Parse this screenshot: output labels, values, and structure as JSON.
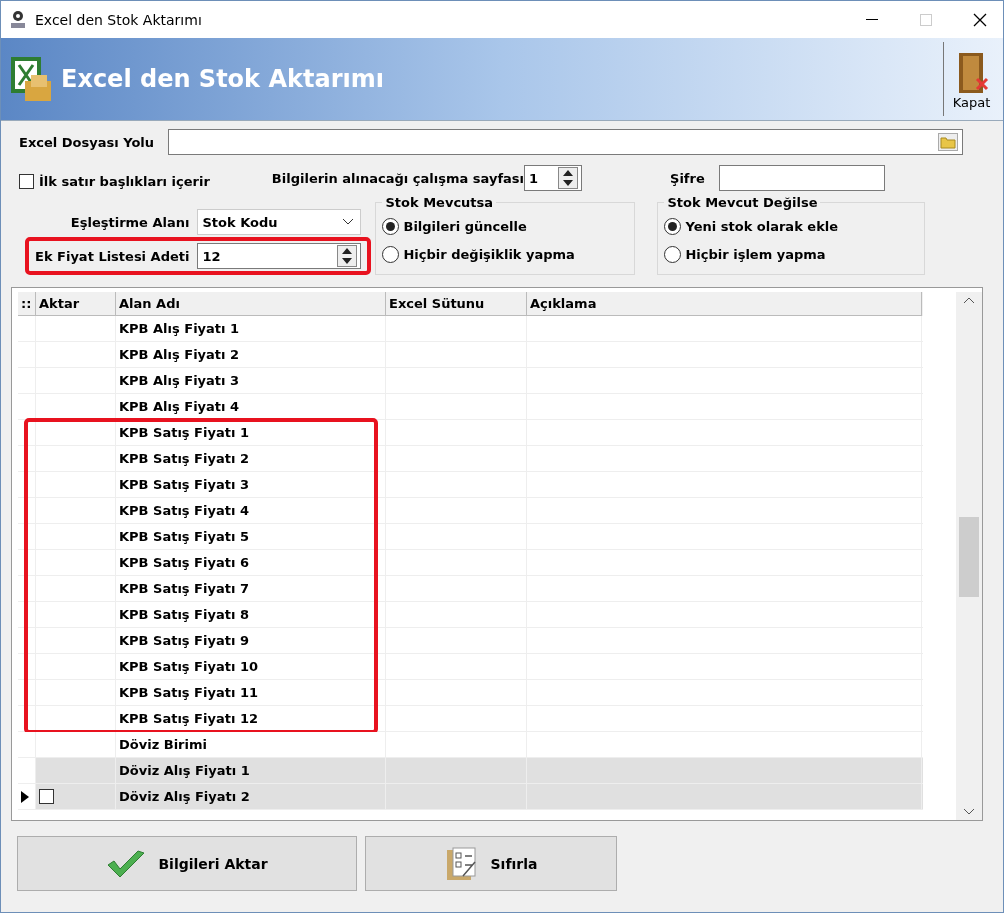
{
  "window": {
    "title": "Excel den Stok Aktarımı"
  },
  "header": {
    "title": "Excel den Stok Aktarımı",
    "close_button": "Kapat"
  },
  "form": {
    "file_path": {
      "label": "Excel Dosyası Yolu"
    },
    "header_row": {
      "label": "İlk satır başlıkları içerir",
      "checked": false
    },
    "sheet": {
      "label": "Bilgilerin alınacağı çalışma sayfası",
      "value": "1"
    },
    "password": {
      "label": "Şifre"
    },
    "match_field": {
      "label": "Eşleştirme Alanı",
      "value": "Stok Kodu"
    },
    "price_list_count": {
      "label": "Ek Fiyat Listesi Adeti",
      "value": "12",
      "highlighted": true
    },
    "if_exists": {
      "title": "Stok Mevcutsa",
      "options": [
        {
          "label": "Bilgileri güncelle",
          "selected": true
        },
        {
          "label": "Hiçbir değişiklik yapma",
          "selected": false
        }
      ]
    },
    "if_missing": {
      "title": "Stok Mevcut Değilse",
      "options": [
        {
          "label": "Yeni stok olarak ekle",
          "selected": true
        },
        {
          "label": "Hiçbir işlem yapma",
          "selected": false
        }
      ]
    }
  },
  "table": {
    "indicator": "::",
    "columns": [
      "Aktar",
      "Alan Adı",
      "Excel Sütunu",
      "Açıklama"
    ],
    "row_groups": [
      {
        "highlighted": false,
        "rows": [
          {
            "field": "KPB Alış Fiyatı 1",
            "selected": false
          },
          {
            "field": "KPB Alış Fiyatı 2",
            "selected": false
          },
          {
            "field": "KPB Alış Fiyatı 3",
            "selected": false
          },
          {
            "field": "KPB Alış Fiyatı 4",
            "selected": false
          }
        ]
      },
      {
        "highlighted": true,
        "rows": [
          {
            "field": "KPB Satış Fiyatı 1",
            "selected": false
          },
          {
            "field": "KPB Satış Fiyatı 2",
            "selected": false
          },
          {
            "field": "KPB Satış Fiyatı 3",
            "selected": false
          },
          {
            "field": "KPB Satış Fiyatı 4",
            "selected": false
          },
          {
            "field": "KPB Satış Fiyatı 5",
            "selected": false
          },
          {
            "field": "KPB Satış Fiyatı 6",
            "selected": false
          },
          {
            "field": "KPB Satış Fiyatı 7",
            "selected": false
          },
          {
            "field": "KPB Satış Fiyatı 8",
            "selected": false
          },
          {
            "field": "KPB Satış Fiyatı 9",
            "selected": false
          },
          {
            "field": "KPB Satış Fiyatı 10",
            "selected": false
          },
          {
            "field": "KPB Satış Fiyatı 11",
            "selected": false
          },
          {
            "field": "KPB Satış Fiyatı 12",
            "selected": false
          }
        ]
      },
      {
        "highlighted": false,
        "rows": [
          {
            "field": "Döviz Birimi",
            "selected": false
          },
          {
            "field": "Döviz Alış Fiyatı 1",
            "selected": true
          },
          {
            "field": "Döviz Alış Fiyatı 2",
            "selected": true,
            "current": true,
            "checked": false
          }
        ]
      }
    ]
  },
  "buttons": [
    {
      "kind": "transfer",
      "label": "Bilgileri Aktar"
    },
    {
      "kind": "reset",
      "label": "Sıfırla"
    }
  ]
}
